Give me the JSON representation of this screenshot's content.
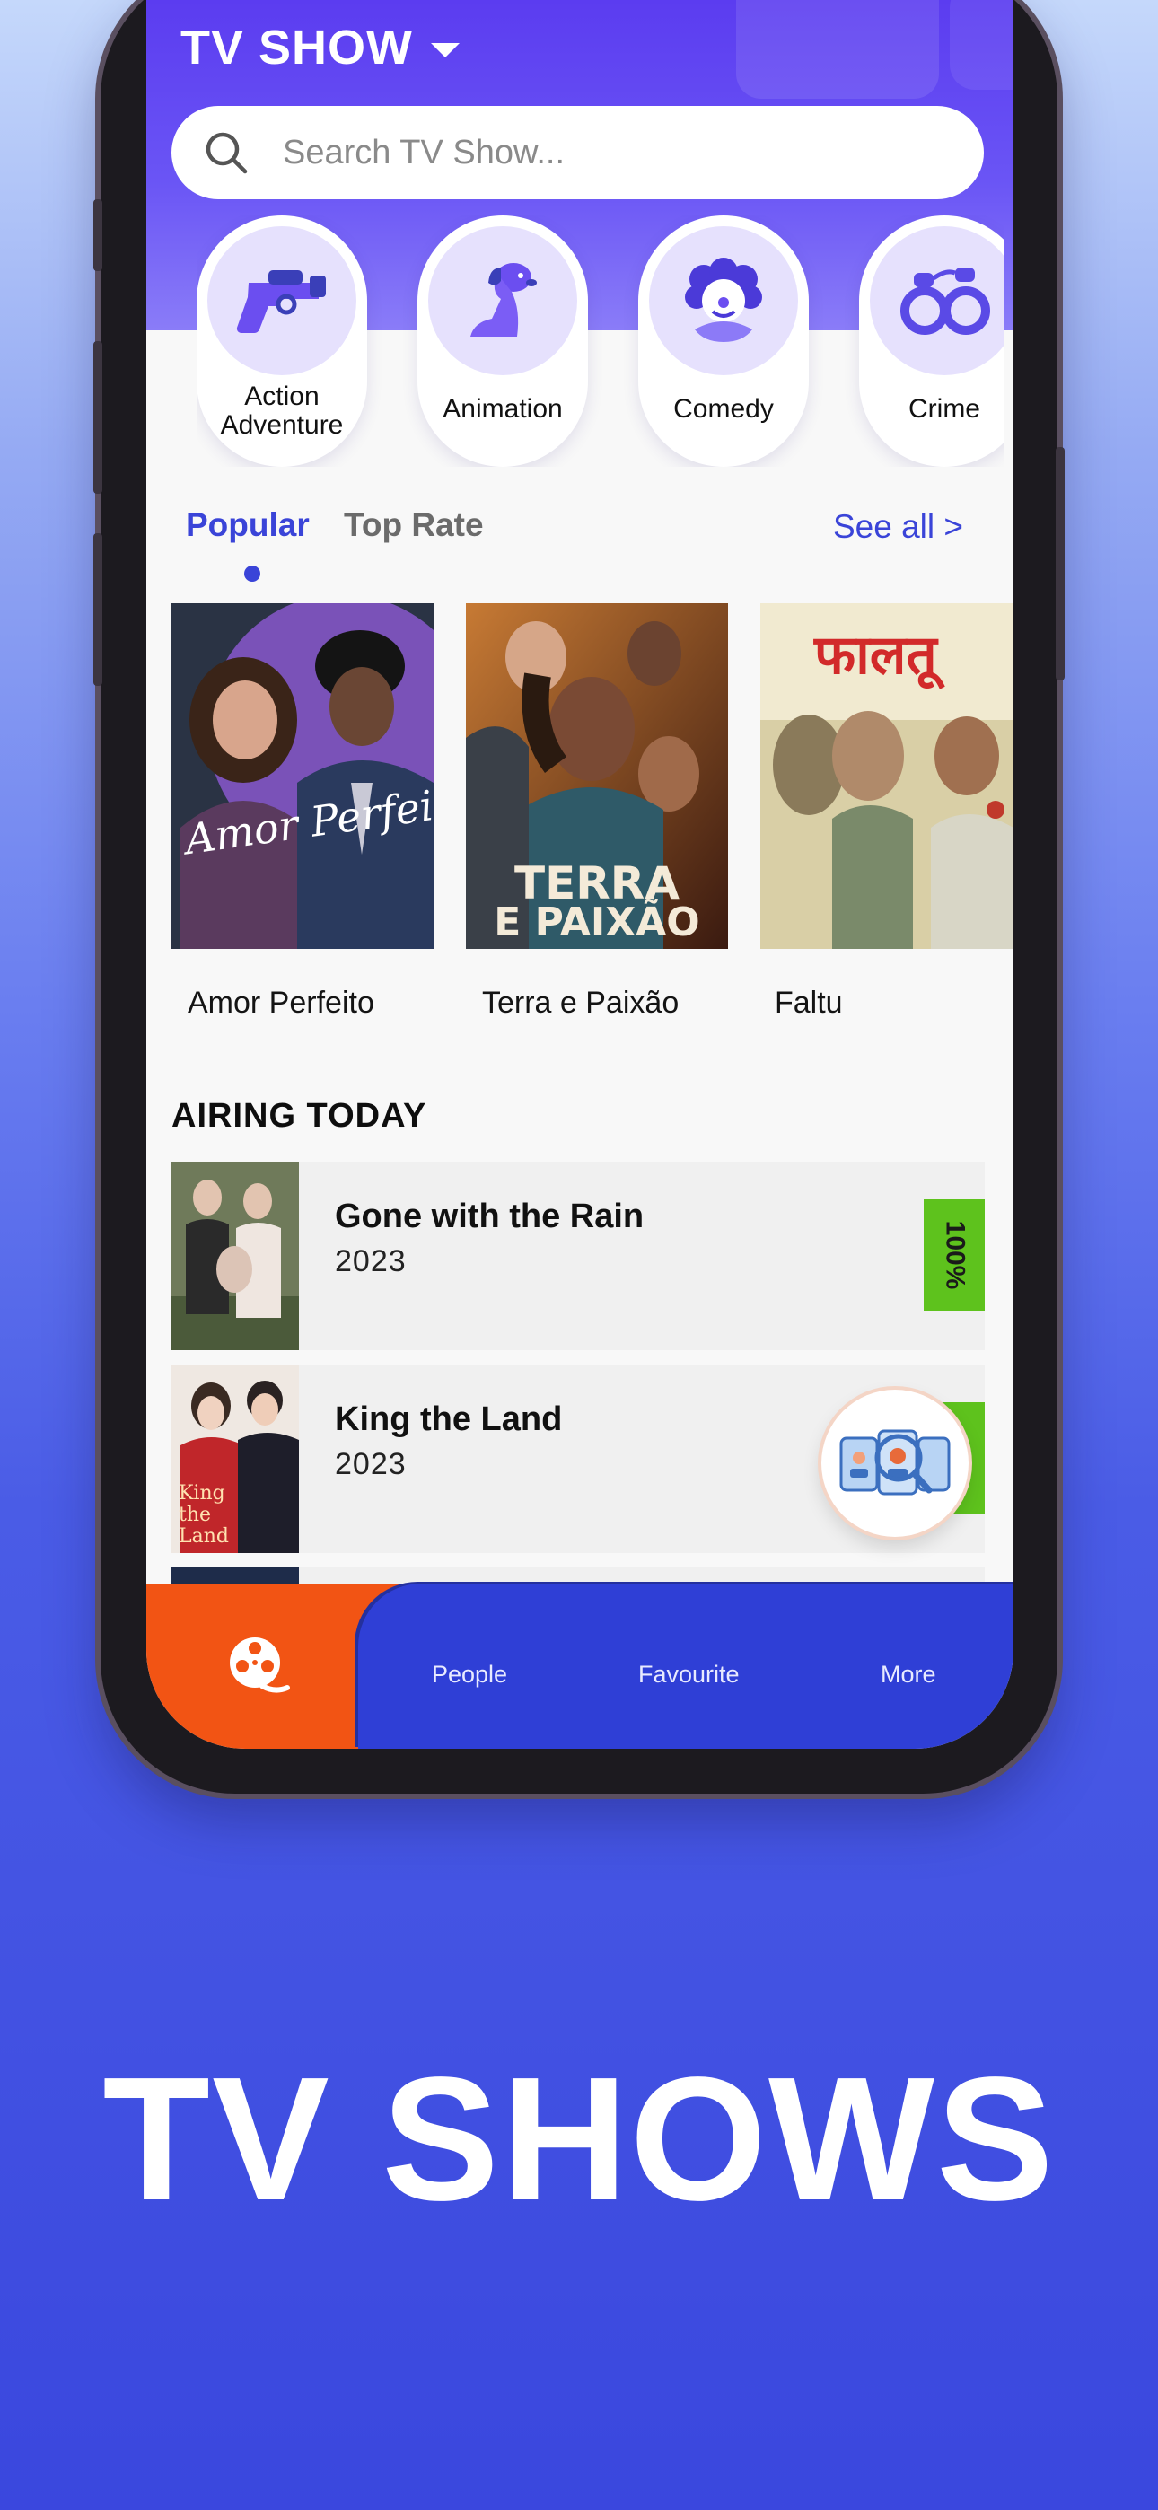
{
  "header": {
    "title": "TV SHOW",
    "search_placeholder": "Search TV Show..."
  },
  "genres": [
    {
      "label": "Action Adventure",
      "icon": "revolver-icon"
    },
    {
      "label": "Animation",
      "icon": "dog-icon"
    },
    {
      "label": "Comedy",
      "icon": "clown-icon"
    },
    {
      "label": "Crime",
      "icon": "handcuffs-icon"
    }
  ],
  "tabs": {
    "popular": "Popular",
    "top_rate": "Top Rate",
    "see_all": "See all >"
  },
  "popular": [
    {
      "title": "Amor Perfeito",
      "poster_text": "Amor Perfeito"
    },
    {
      "title": "Terra e Paixão",
      "poster_text_1": "TERRA",
      "poster_text_2": "E PAIXÃO"
    },
    {
      "title": "Faltu",
      "poster_text": "फालतू"
    }
  ],
  "airing": {
    "heading": "AIRING TODAY",
    "items": [
      {
        "title": "Gone with the Rain",
        "year": "2023",
        "rating": "100%"
      },
      {
        "title": "King the Land",
        "year": "2023",
        "poster_text": "King the Land"
      }
    ]
  },
  "nav": {
    "people": "People",
    "favourite": "Favourite",
    "more": "More"
  },
  "caption": "TV SHOWS",
  "colors": {
    "accent": "#3a44d8",
    "header": "#5b3cf0",
    "nav_orange": "#f25414",
    "nav_blue": "#2f3fd6",
    "badge_green": "#5ec21d"
  }
}
